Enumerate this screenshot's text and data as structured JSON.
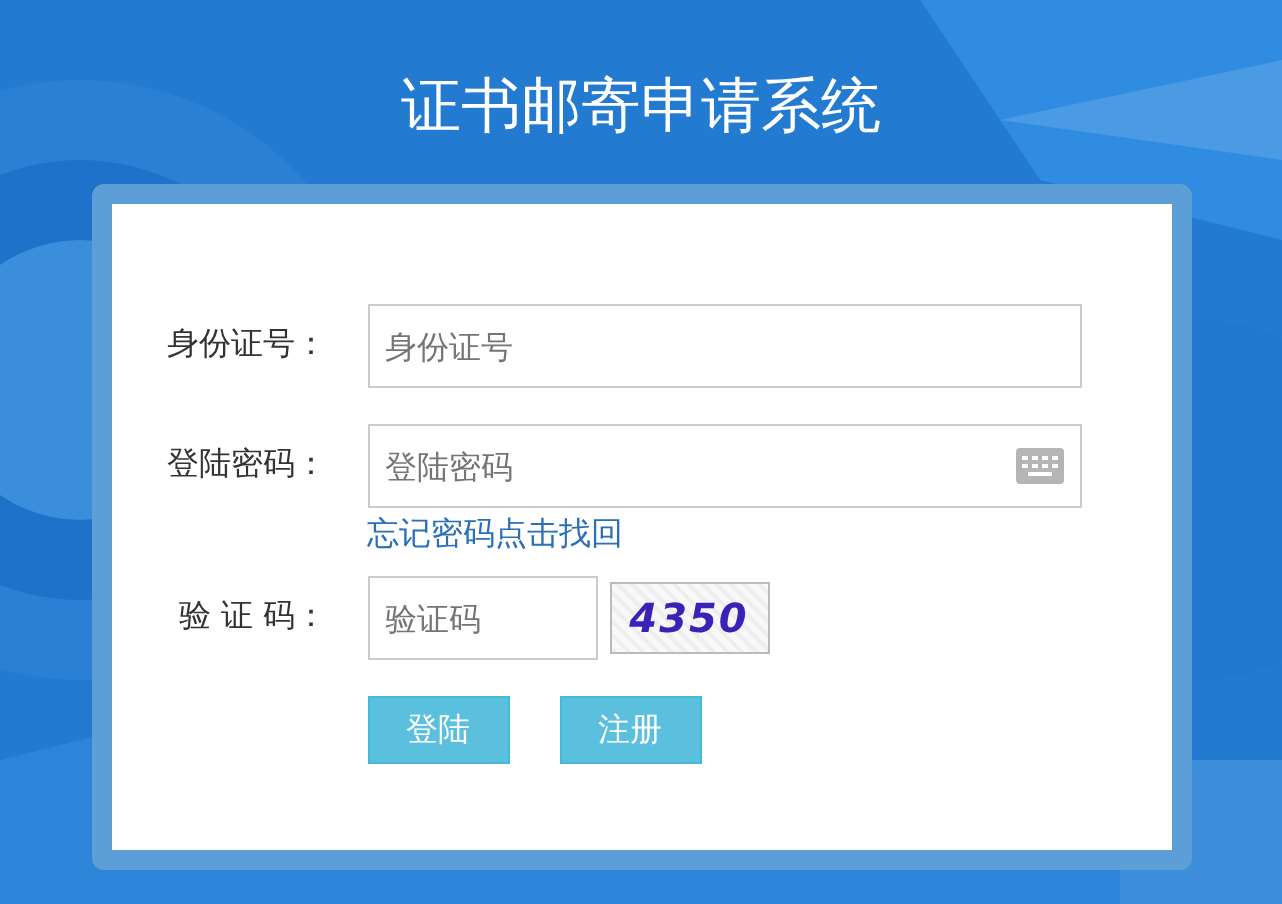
{
  "title": "证书邮寄申请系统",
  "fields": [
    {
      "kind": "text",
      "label": "身份证号：",
      "placeholder": "身份证号"
    },
    {
      "kind": "password",
      "label": "登陆密码：",
      "placeholder": "登陆密码",
      "link": "忘记密码点击找回"
    },
    {
      "kind": "captcha",
      "label": "验 证 码：",
      "placeholder": "验证码",
      "captcha": "4350"
    }
  ],
  "buttons": [
    "登陆",
    "注册"
  ]
}
